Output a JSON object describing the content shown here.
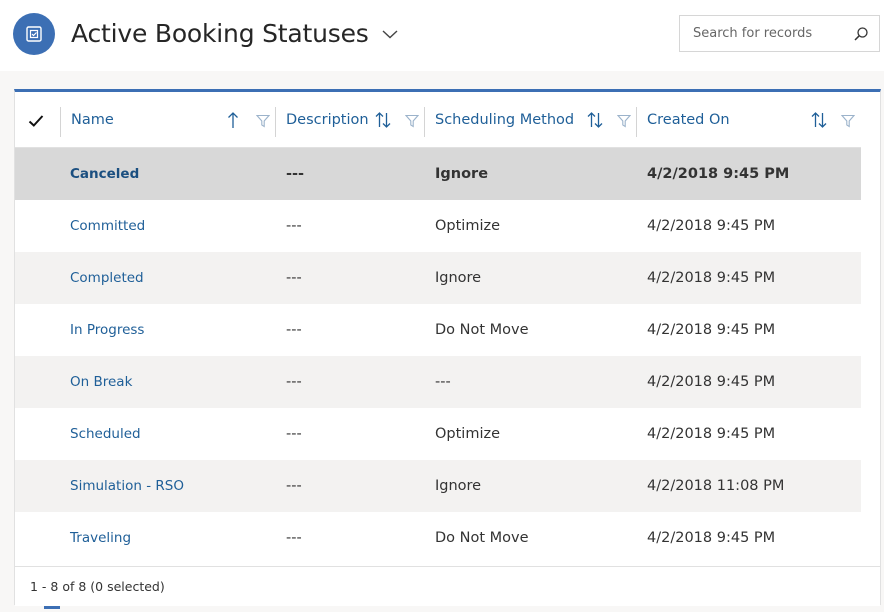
{
  "header": {
    "title": "Active Booking Statuses",
    "entity_icon": "booking-status-icon",
    "chevron_icon": "chevron-down-icon",
    "search_placeholder": "Search for records",
    "search_icon": "search-icon"
  },
  "grid": {
    "columns": [
      {
        "key": "name",
        "label": "Name",
        "sort": "ascending"
      },
      {
        "key": "description",
        "label": "Description",
        "sort": "none"
      },
      {
        "key": "scheduling_method",
        "label": "Scheduling Method",
        "sort": "none"
      },
      {
        "key": "created_on",
        "label": "Created On",
        "sort": "none"
      }
    ],
    "rows": [
      {
        "name": "Canceled",
        "description": "---",
        "scheduling_method": "Ignore",
        "created_on": "4/2/2018 9:45 PM",
        "selected": true
      },
      {
        "name": "Committed",
        "description": "---",
        "scheduling_method": "Optimize",
        "created_on": "4/2/2018 9:45 PM"
      },
      {
        "name": "Completed",
        "description": "---",
        "scheduling_method": "Ignore",
        "created_on": "4/2/2018 9:45 PM"
      },
      {
        "name": "In Progress",
        "description": "---",
        "scheduling_method": "Do Not Move",
        "created_on": "4/2/2018 9:45 PM"
      },
      {
        "name": "On Break",
        "description": "---",
        "scheduling_method": "---",
        "created_on": "4/2/2018 9:45 PM"
      },
      {
        "name": "Scheduled",
        "description": "---",
        "scheduling_method": "Optimize",
        "created_on": "4/2/2018 9:45 PM"
      },
      {
        "name": "Simulation - RSO",
        "description": "---",
        "scheduling_method": "Ignore",
        "created_on": "4/2/2018 11:08 PM"
      },
      {
        "name": "Traveling",
        "description": "---",
        "scheduling_method": "Do Not Move",
        "created_on": "4/2/2018 9:45 PM"
      }
    ],
    "footer": "1 - 8 of 8 (0 selected)"
  },
  "colors": {
    "accent": "#3c6fb4",
    "link": "#1f5f98",
    "selected_row": "#d8d8d8",
    "alt_row": "#f3f2f1"
  }
}
